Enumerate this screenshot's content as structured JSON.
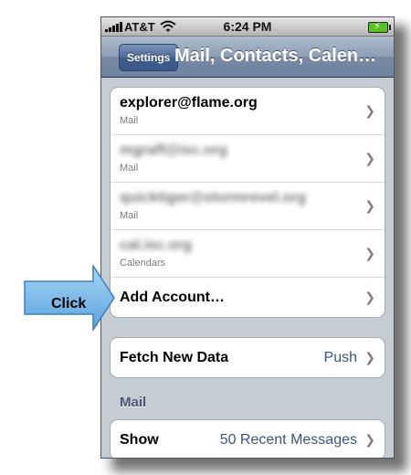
{
  "status_bar": {
    "carrier": "AT&T",
    "time": "6:24 PM"
  },
  "nav": {
    "back_label": "Settings",
    "title": "Mail, Contacts, Calen…"
  },
  "accounts": [
    {
      "title": "explorer@flame.org",
      "subtitle": "Mail"
    },
    {
      "title": "mgraff@isc.org",
      "subtitle": "Mail"
    },
    {
      "title": "quicktiger@stormrevel.org",
      "subtitle": "Mail"
    },
    {
      "title": "cal.isc.org",
      "subtitle": "Calendars"
    }
  ],
  "add_account_label": "Add Account…",
  "fetch": {
    "label": "Fetch New Data",
    "value": "Push"
  },
  "mail_section_header": "Mail",
  "show": {
    "label": "Show",
    "value": "50 Recent Messages"
  },
  "callout": {
    "label": "Click",
    "color": "#7ab8e8"
  }
}
